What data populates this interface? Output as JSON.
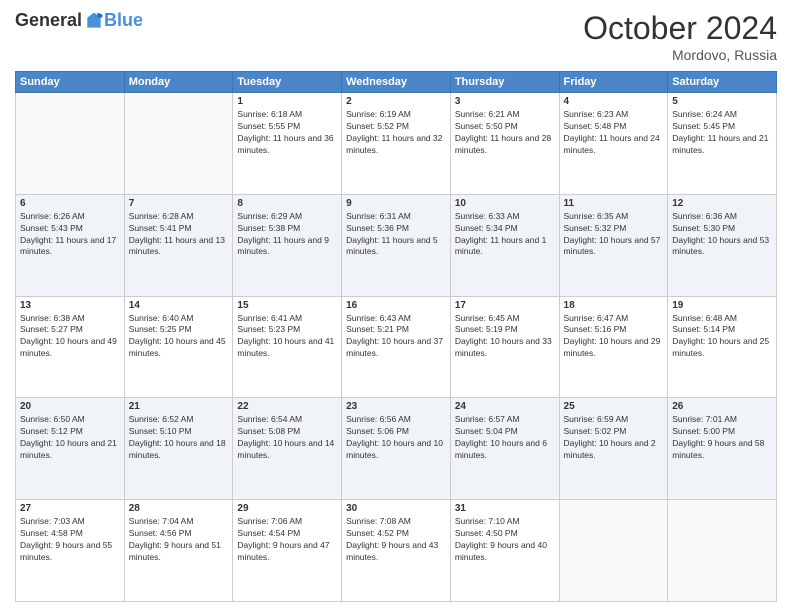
{
  "header": {
    "logo": {
      "general": "General",
      "blue": "Blue"
    },
    "title": "October 2024",
    "location": "Mordovo, Russia"
  },
  "weekdays": [
    "Sunday",
    "Monday",
    "Tuesday",
    "Wednesday",
    "Thursday",
    "Friday",
    "Saturday"
  ],
  "weeks": [
    [
      {
        "day": "",
        "info": ""
      },
      {
        "day": "",
        "info": ""
      },
      {
        "day": "1",
        "info": "Sunrise: 6:18 AM\nSunset: 5:55 PM\nDaylight: 11 hours and 36 minutes."
      },
      {
        "day": "2",
        "info": "Sunrise: 6:19 AM\nSunset: 5:52 PM\nDaylight: 11 hours and 32 minutes."
      },
      {
        "day": "3",
        "info": "Sunrise: 6:21 AM\nSunset: 5:50 PM\nDaylight: 11 hours and 28 minutes."
      },
      {
        "day": "4",
        "info": "Sunrise: 6:23 AM\nSunset: 5:48 PM\nDaylight: 11 hours and 24 minutes."
      },
      {
        "day": "5",
        "info": "Sunrise: 6:24 AM\nSunset: 5:45 PM\nDaylight: 11 hours and 21 minutes."
      }
    ],
    [
      {
        "day": "6",
        "info": "Sunrise: 6:26 AM\nSunset: 5:43 PM\nDaylight: 11 hours and 17 minutes."
      },
      {
        "day": "7",
        "info": "Sunrise: 6:28 AM\nSunset: 5:41 PM\nDaylight: 11 hours and 13 minutes."
      },
      {
        "day": "8",
        "info": "Sunrise: 6:29 AM\nSunset: 5:38 PM\nDaylight: 11 hours and 9 minutes."
      },
      {
        "day": "9",
        "info": "Sunrise: 6:31 AM\nSunset: 5:36 PM\nDaylight: 11 hours and 5 minutes."
      },
      {
        "day": "10",
        "info": "Sunrise: 6:33 AM\nSunset: 5:34 PM\nDaylight: 11 hours and 1 minute."
      },
      {
        "day": "11",
        "info": "Sunrise: 6:35 AM\nSunset: 5:32 PM\nDaylight: 10 hours and 57 minutes."
      },
      {
        "day": "12",
        "info": "Sunrise: 6:36 AM\nSunset: 5:30 PM\nDaylight: 10 hours and 53 minutes."
      }
    ],
    [
      {
        "day": "13",
        "info": "Sunrise: 6:38 AM\nSunset: 5:27 PM\nDaylight: 10 hours and 49 minutes."
      },
      {
        "day": "14",
        "info": "Sunrise: 6:40 AM\nSunset: 5:25 PM\nDaylight: 10 hours and 45 minutes."
      },
      {
        "day": "15",
        "info": "Sunrise: 6:41 AM\nSunset: 5:23 PM\nDaylight: 10 hours and 41 minutes."
      },
      {
        "day": "16",
        "info": "Sunrise: 6:43 AM\nSunset: 5:21 PM\nDaylight: 10 hours and 37 minutes."
      },
      {
        "day": "17",
        "info": "Sunrise: 6:45 AM\nSunset: 5:19 PM\nDaylight: 10 hours and 33 minutes."
      },
      {
        "day": "18",
        "info": "Sunrise: 6:47 AM\nSunset: 5:16 PM\nDaylight: 10 hours and 29 minutes."
      },
      {
        "day": "19",
        "info": "Sunrise: 6:48 AM\nSunset: 5:14 PM\nDaylight: 10 hours and 25 minutes."
      }
    ],
    [
      {
        "day": "20",
        "info": "Sunrise: 6:50 AM\nSunset: 5:12 PM\nDaylight: 10 hours and 21 minutes."
      },
      {
        "day": "21",
        "info": "Sunrise: 6:52 AM\nSunset: 5:10 PM\nDaylight: 10 hours and 18 minutes."
      },
      {
        "day": "22",
        "info": "Sunrise: 6:54 AM\nSunset: 5:08 PM\nDaylight: 10 hours and 14 minutes."
      },
      {
        "day": "23",
        "info": "Sunrise: 6:56 AM\nSunset: 5:06 PM\nDaylight: 10 hours and 10 minutes."
      },
      {
        "day": "24",
        "info": "Sunrise: 6:57 AM\nSunset: 5:04 PM\nDaylight: 10 hours and 6 minutes."
      },
      {
        "day": "25",
        "info": "Sunrise: 6:59 AM\nSunset: 5:02 PM\nDaylight: 10 hours and 2 minutes."
      },
      {
        "day": "26",
        "info": "Sunrise: 7:01 AM\nSunset: 5:00 PM\nDaylight: 9 hours and 58 minutes."
      }
    ],
    [
      {
        "day": "27",
        "info": "Sunrise: 7:03 AM\nSunset: 4:58 PM\nDaylight: 9 hours and 55 minutes."
      },
      {
        "day": "28",
        "info": "Sunrise: 7:04 AM\nSunset: 4:56 PM\nDaylight: 9 hours and 51 minutes."
      },
      {
        "day": "29",
        "info": "Sunrise: 7:06 AM\nSunset: 4:54 PM\nDaylight: 9 hours and 47 minutes."
      },
      {
        "day": "30",
        "info": "Sunrise: 7:08 AM\nSunset: 4:52 PM\nDaylight: 9 hours and 43 minutes."
      },
      {
        "day": "31",
        "info": "Sunrise: 7:10 AM\nSunset: 4:50 PM\nDaylight: 9 hours and 40 minutes."
      },
      {
        "day": "",
        "info": ""
      },
      {
        "day": "",
        "info": ""
      }
    ]
  ]
}
